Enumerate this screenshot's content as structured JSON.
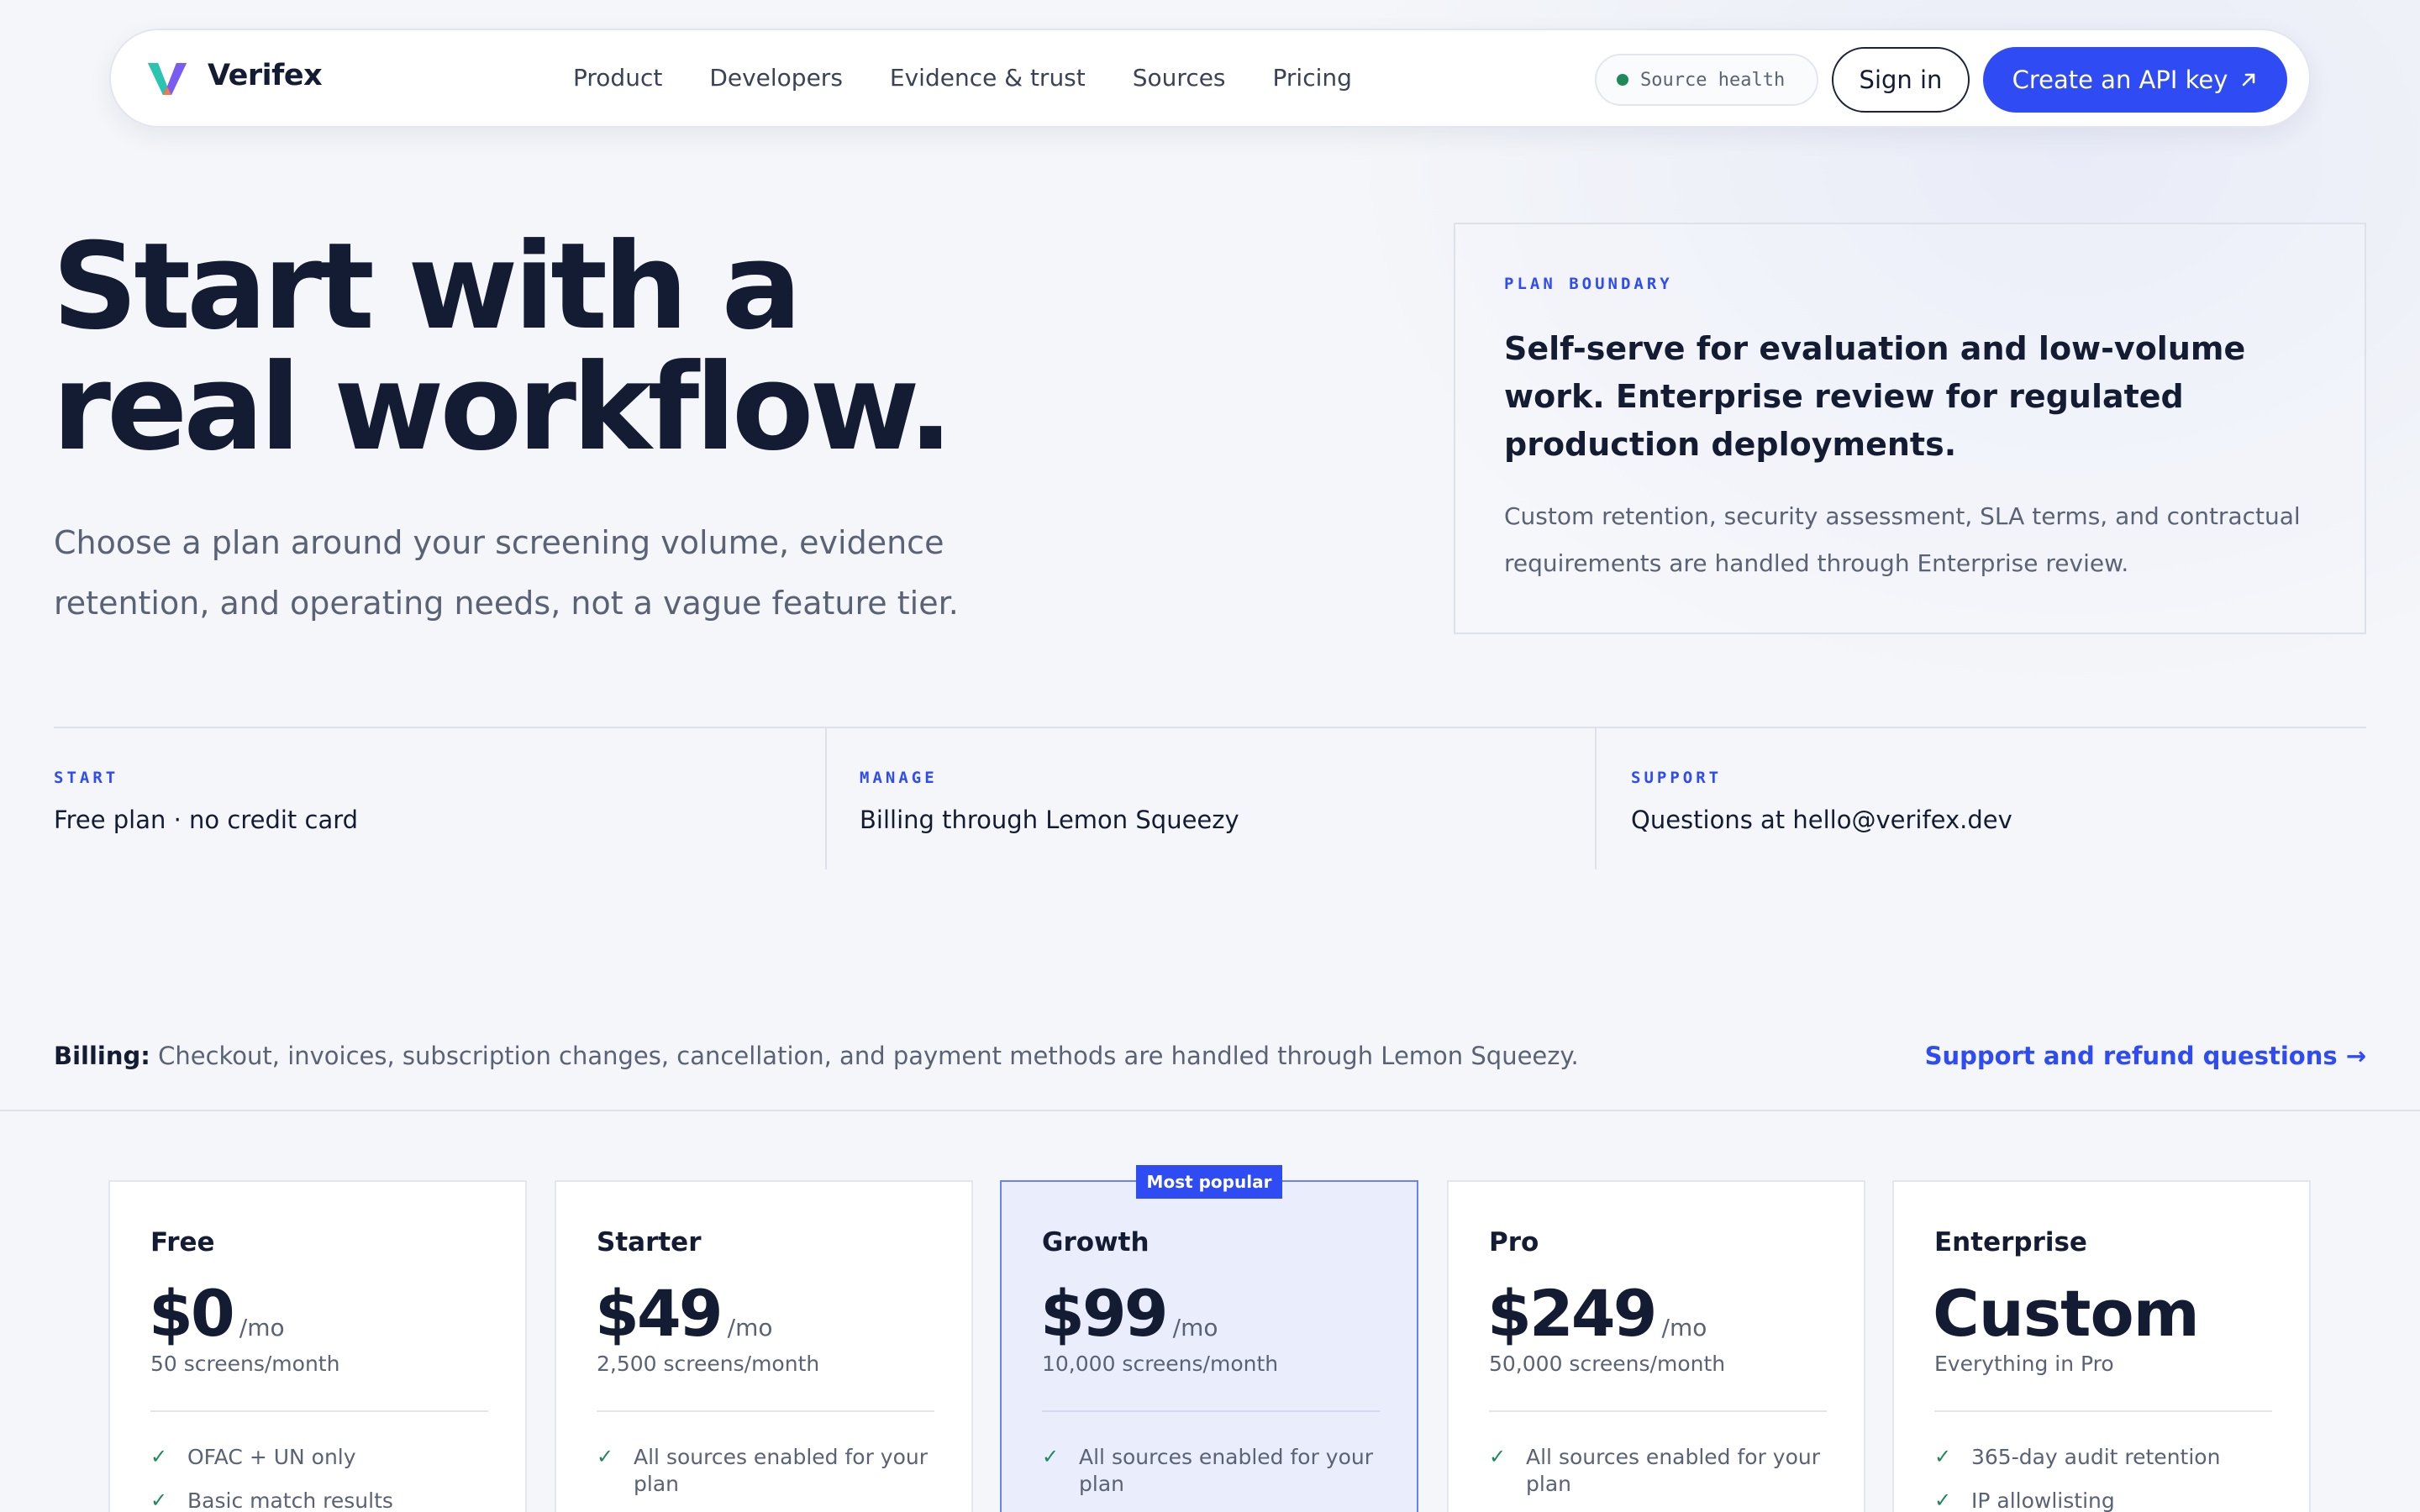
{
  "nav": {
    "brand": "Verifex",
    "links": [
      "Product",
      "Developers",
      "Evidence & trust",
      "Sources",
      "Pricing"
    ],
    "source_health": "Source health",
    "sign_in": "Sign in",
    "cta": "Create an API key",
    "cta_icon": "arrow-up-right-icon",
    "status_color": "#1e8a5a",
    "accent": "#2f4cf4"
  },
  "hero": {
    "title_line1": "Start with a",
    "title_line2": "real workflow.",
    "subtitle": "Choose a plan around your screening volume, evidence retention, and operating needs, not a vague feature tier."
  },
  "plan_boundary": {
    "eyebrow": "PLAN BOUNDARY",
    "headline": "Self-serve for evaluation and low-volume work. Enterprise review for regulated production deployments.",
    "body": "Custom retention, security assessment, SLA terms, and contractual requirements are handled through Enterprise review."
  },
  "strip": [
    {
      "eyebrow": "START",
      "value": "Free plan · no credit card"
    },
    {
      "eyebrow": "MANAGE",
      "value": "Billing through Lemon Squeezy"
    },
    {
      "eyebrow": "SUPPORT",
      "value": "Questions at hello@verifex.dev"
    }
  ],
  "billing": {
    "label": "Billing:",
    "text": "Checkout, invoices, subscription changes, cancellation, and payment methods are handled through Lemon Squeezy.",
    "support_link": "Support and refund questions →"
  },
  "plans": [
    {
      "name": "Free",
      "price": "$0",
      "unit": "/mo",
      "screens": "50 screens/month",
      "features": [
        "OFAC + UN only",
        "Basic match results"
      ]
    },
    {
      "name": "Starter",
      "price": "$49",
      "unit": "/mo",
      "screens": "2,500 screens/month",
      "features": [
        "All sources enabled for your plan"
      ]
    },
    {
      "name": "Growth",
      "price": "$99",
      "unit": "/mo",
      "screens": "10,000 screens/month",
      "features": [
        "All sources enabled for your plan"
      ],
      "badge": "Most popular"
    },
    {
      "name": "Pro",
      "price": "$249",
      "unit": "/mo",
      "screens": "50,000 screens/month",
      "features": [
        "All sources enabled for your plan"
      ]
    },
    {
      "name": "Enterprise",
      "price": "Custom",
      "unit": "",
      "screens": "Everything in Pro",
      "features": [
        "365-day audit retention",
        "IP allowlisting"
      ]
    }
  ]
}
